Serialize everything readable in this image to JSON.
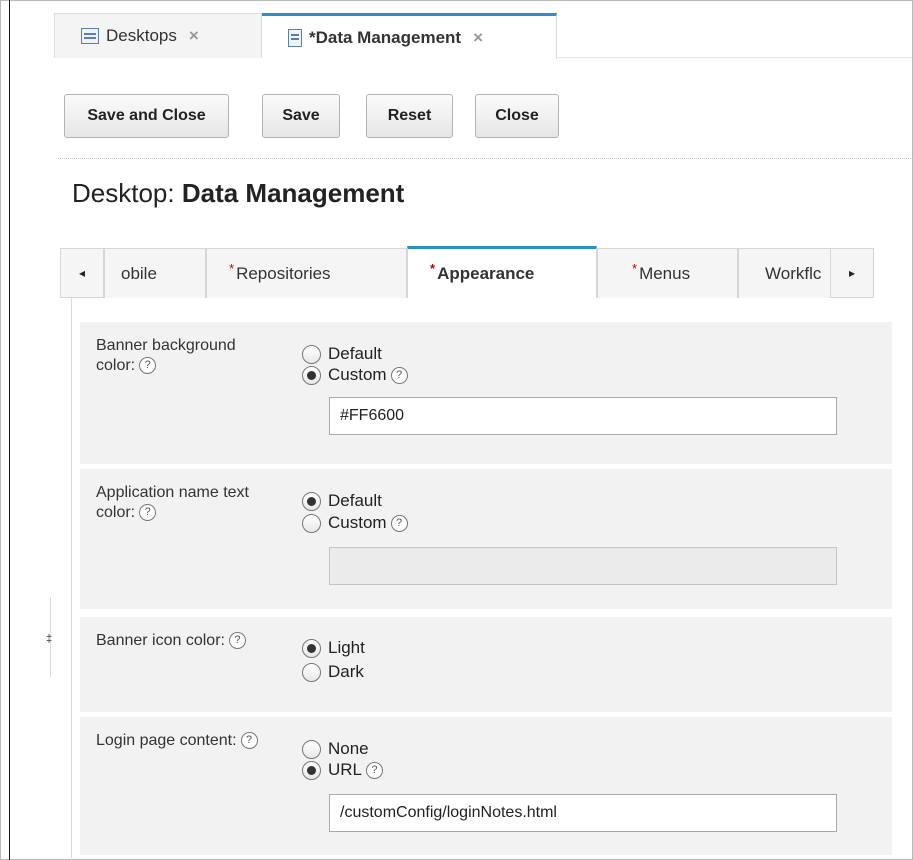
{
  "doc_tabs": [
    {
      "label": "Desktops",
      "close": "×"
    },
    {
      "label": "*Data Management",
      "close": "×"
    }
  ],
  "toolbar": {
    "save_and_close": "Save and Close",
    "save": "Save",
    "reset": "Reset",
    "close": "Close"
  },
  "page_title": {
    "prefix": "Desktop: ",
    "name": "Data Management"
  },
  "settings_tabs": [
    {
      "label": "obile",
      "required": false
    },
    {
      "label": "Repositories",
      "required": true
    },
    {
      "label": "Appearance",
      "required": true
    },
    {
      "label": "Menus",
      "required": true
    },
    {
      "label": "Workflc",
      "required": false
    }
  ],
  "scroll": {
    "left": "◂",
    "right": "▸"
  },
  "help_symbol": "?",
  "settings": {
    "banner_bg": {
      "label": "Banner background color:",
      "options": [
        "Default",
        "Custom"
      ],
      "selected": "Custom",
      "value": "#FF6600"
    },
    "app_name_color": {
      "label": "Application name text color:",
      "options": [
        "Default",
        "Custom"
      ],
      "selected": "Default",
      "value": ""
    },
    "banner_icon": {
      "label": "Banner icon color:",
      "options": [
        "Light",
        "Dark"
      ],
      "selected": "Light"
    },
    "login_content": {
      "label": "Login page content:",
      "options": [
        "None",
        "URL"
      ],
      "selected": "URL",
      "value": "/customConfig/loginNotes.html"
    }
  },
  "side_marker": "‡",
  "colors": {
    "accent": "#2d8ec8",
    "required": "#cc0000",
    "panel_bg": "#f2f2f2"
  }
}
